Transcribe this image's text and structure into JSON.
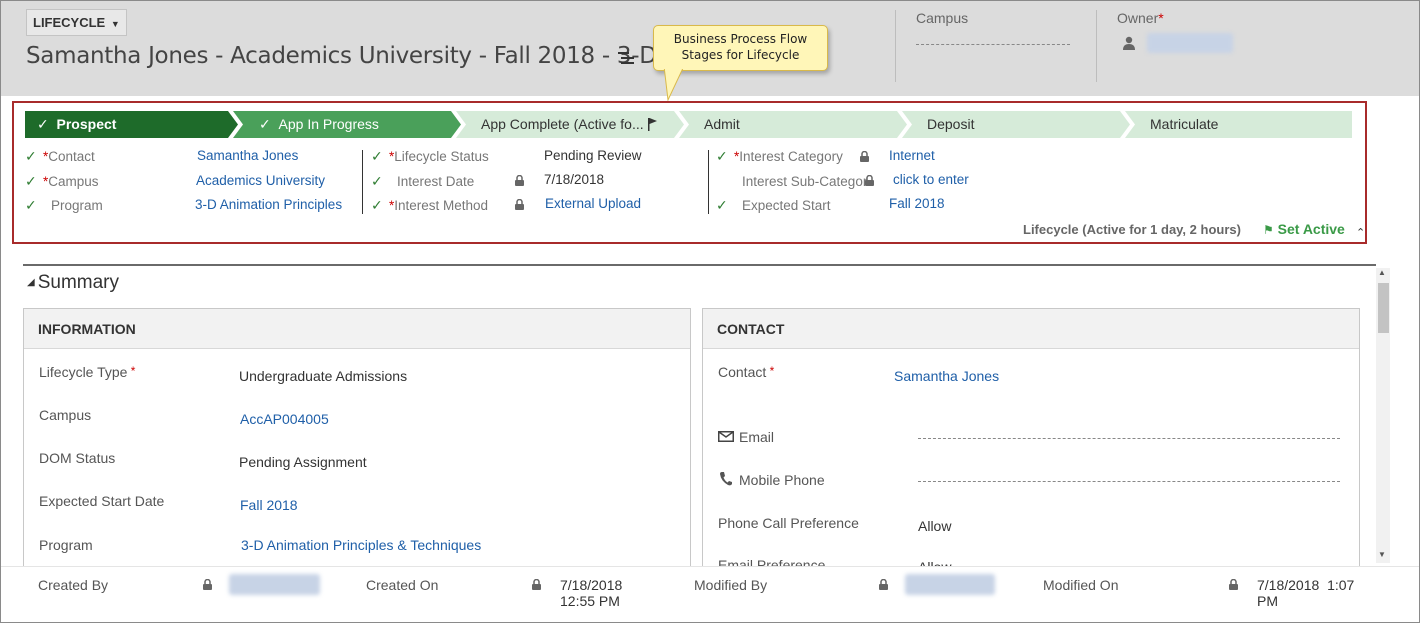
{
  "header": {
    "entity_label": "LIFECYCLE",
    "title": "Samantha Jones - Academics University - Fall 2018 - 3-D...",
    "campus_label": "Campus",
    "owner_label": "Owner",
    "required_mark": "*"
  },
  "callout": {
    "line1": "Business Process Flow",
    "line2": "Stages for Lifecycle"
  },
  "bpf": {
    "stages": [
      {
        "label": "Prospect",
        "state": "completed"
      },
      {
        "label": "App In Progress",
        "state": "completed"
      },
      {
        "label": "App Complete (Active fo...",
        "state": "active"
      },
      {
        "label": "Admit",
        "state": "future"
      },
      {
        "label": "Deposit",
        "state": "future"
      },
      {
        "label": "Matriculate",
        "state": "future"
      }
    ],
    "fields": {
      "contact_label": "Contact",
      "contact_value": "Samantha Jones",
      "campus_label": "Campus",
      "campus_value": "Academics University",
      "program_label": "Program",
      "program_value": "3-D Animation Principles",
      "lifecycle_status_label": "Lifecycle Status",
      "lifecycle_status_value": "Pending Review",
      "interest_date_label": "Interest Date",
      "interest_date_value": "7/18/2018",
      "interest_method_label": "Interest Method",
      "interest_method_value": "External Upload",
      "interest_category_label": "Interest Category",
      "interest_category_value": "Internet",
      "interest_subcategory_label": "Interest Sub-Categor",
      "interest_subcategory_value": "click to enter",
      "expected_start_label": "Expected Start",
      "expected_start_value": "Fall 2018"
    },
    "status_text": "Lifecycle (Active for 1 day, 2 hours)",
    "set_active_label": "Set Active"
  },
  "summary": {
    "title": "Summary",
    "information": {
      "heading": "INFORMATION",
      "rows": [
        {
          "label": "Lifecycle Type",
          "value": "Undergraduate Admissions"
        },
        {
          "label": "Campus",
          "value": "AccAP004005"
        },
        {
          "label": "DOM Status",
          "value": "Pending Assignment"
        },
        {
          "label": "Expected Start Date",
          "value": "Fall 2018"
        },
        {
          "label": "Program",
          "value": "3-D Animation Principles & Techniques"
        }
      ]
    },
    "contact": {
      "heading": "CONTACT",
      "contact_label": "Contact",
      "contact_value": "Samantha Jones",
      "email_label": "Email",
      "mobile_label": "Mobile Phone",
      "phone_pref_label": "Phone Call Preference",
      "phone_pref_value": "Allow",
      "email_pref_label": "Email Preference",
      "email_pref_value": "Allow"
    }
  },
  "footer": {
    "created_by_label": "Created By",
    "created_on_label": "Created On",
    "created_on_date": "7/18/2018",
    "created_on_time": "12:55 PM",
    "modified_by_label": "Modified By",
    "modified_on_label": "Modified On",
    "modified_on_date": "7/18/2018",
    "modified_on_time_a": "1:07",
    "modified_on_time_b": "PM"
  },
  "colors": {
    "stage_done_dark": "#1e6b2a",
    "stage_done": "#4aa05a",
    "stage_future": "#d6ebd9",
    "link": "#1f5fa8",
    "required": "#cc0000",
    "bpf_border": "#a82b2b"
  }
}
